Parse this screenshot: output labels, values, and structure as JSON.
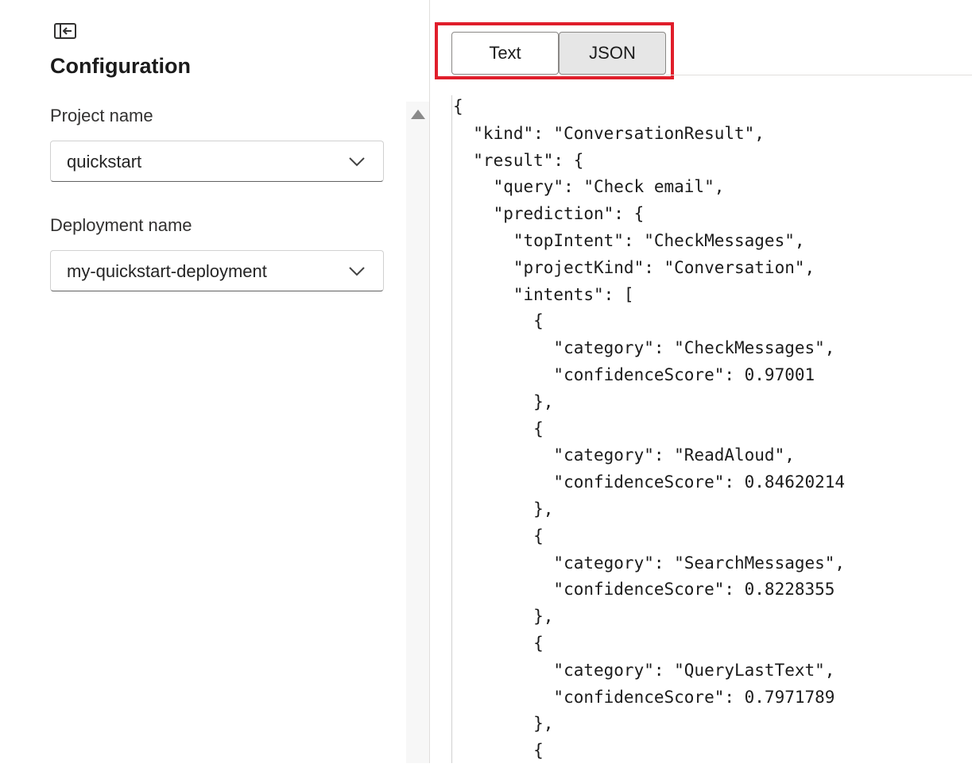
{
  "sidebar": {
    "collapse_icon": "panel-collapse-icon",
    "title": "Configuration",
    "project": {
      "label": "Project name",
      "value": "quickstart",
      "icon": "chevron-down-icon"
    },
    "deployment": {
      "label": "Deployment name",
      "value": "my-quickstart-deployment",
      "icon": "chevron-down-icon"
    }
  },
  "scrollbar": {
    "icon": "scroll-up-arrow-icon"
  },
  "output": {
    "tabs": [
      {
        "label": "Text",
        "selected": false
      },
      {
        "label": "JSON",
        "selected": true
      }
    ],
    "highlight_color": "#e01e2b",
    "json_lines": [
      "{",
      "  \"kind\": \"ConversationResult\",",
      "  \"result\": {",
      "    \"query\": \"Check email\",",
      "    \"prediction\": {",
      "      \"topIntent\": \"CheckMessages\",",
      "      \"projectKind\": \"Conversation\",",
      "      \"intents\": [",
      "        {",
      "          \"category\": \"CheckMessages\",",
      "          \"confidenceScore\": 0.97001",
      "        },",
      "        {",
      "          \"category\": \"ReadAloud\",",
      "          \"confidenceScore\": 0.84620214",
      "        },",
      "        {",
      "          \"category\": \"SearchMessages\",",
      "          \"confidenceScore\": 0.8228355",
      "        },",
      "        {",
      "          \"category\": \"QueryLastText\",",
      "          \"confidenceScore\": 0.7971789",
      "        },",
      "        {"
    ]
  }
}
